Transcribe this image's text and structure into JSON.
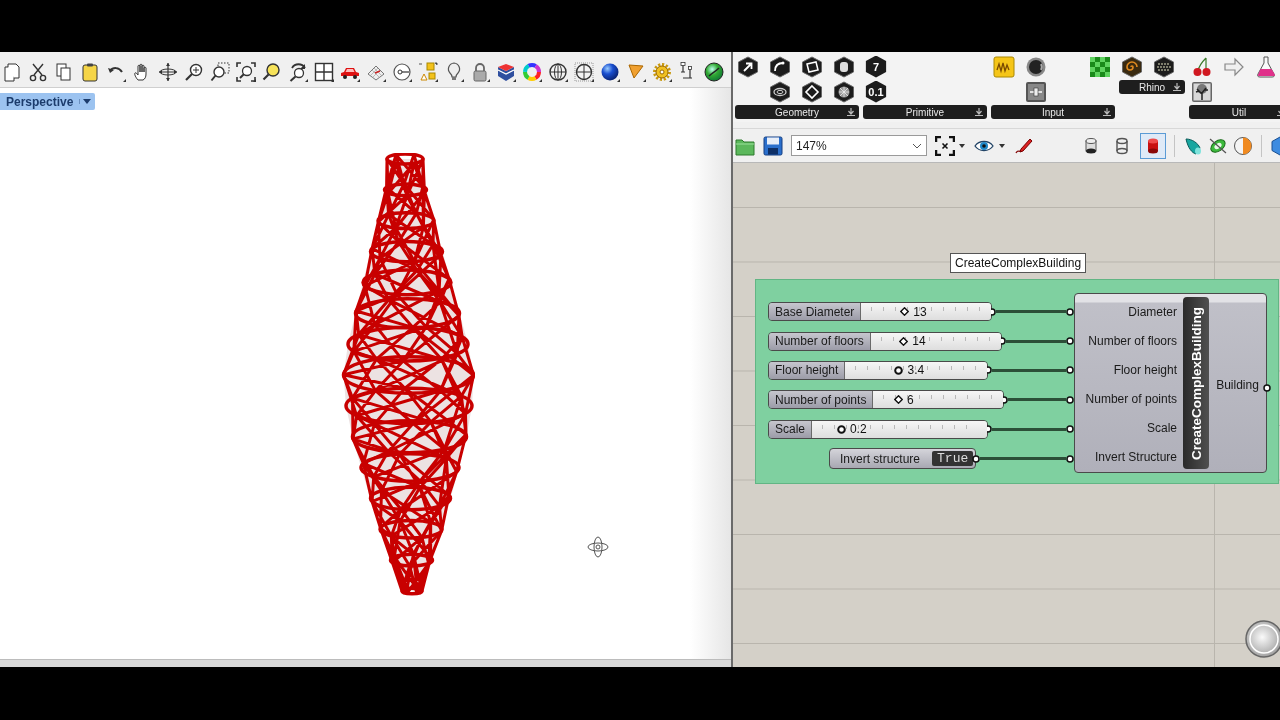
{
  "viewport": {
    "label": "Perspective"
  },
  "component_ribbon": {
    "groups": [
      {
        "label": "Geometry",
        "kind": "geometry"
      },
      {
        "label": "Primitive",
        "kind": "primitive",
        "glyphs": [
          "7",
          "0.1"
        ]
      },
      {
        "label": "Input",
        "kind": "input"
      },
      {
        "label": "Rhino",
        "kind": "rhino"
      },
      {
        "label": "Util",
        "kind": "util"
      }
    ]
  },
  "canvas_toolbar": {
    "zoom": "147%",
    "preview_modes": [
      {
        "selected": false
      },
      {
        "selected": false
      },
      {
        "selected": true
      }
    ]
  },
  "canvas": {
    "group": {
      "label": "CreateComplexBuilding"
    },
    "sliders": [
      {
        "label": "Base Diameter",
        "value": "13",
        "kind": "integer",
        "level": 0.33
      },
      {
        "label": "Number of floors",
        "value": "14",
        "kind": "integer",
        "level": 0.25
      },
      {
        "label": "Floor height",
        "value": "3.4",
        "kind": "decimal",
        "level": 0.375
      },
      {
        "label": "Number of points",
        "value": "6",
        "kind": "integer",
        "level": 0.19
      },
      {
        "label": "Scale",
        "value": "0.2",
        "kind": "decimal",
        "level": 0.165
      }
    ],
    "toggle": {
      "label": "Invert structure",
      "value": "True"
    },
    "component": {
      "name": "CreateComplexBuilding",
      "inputs": [
        "Diameter",
        "Number of floors",
        "Floor height",
        "Number of points",
        "Scale",
        "Invert Structure"
      ],
      "output": "Building"
    }
  }
}
